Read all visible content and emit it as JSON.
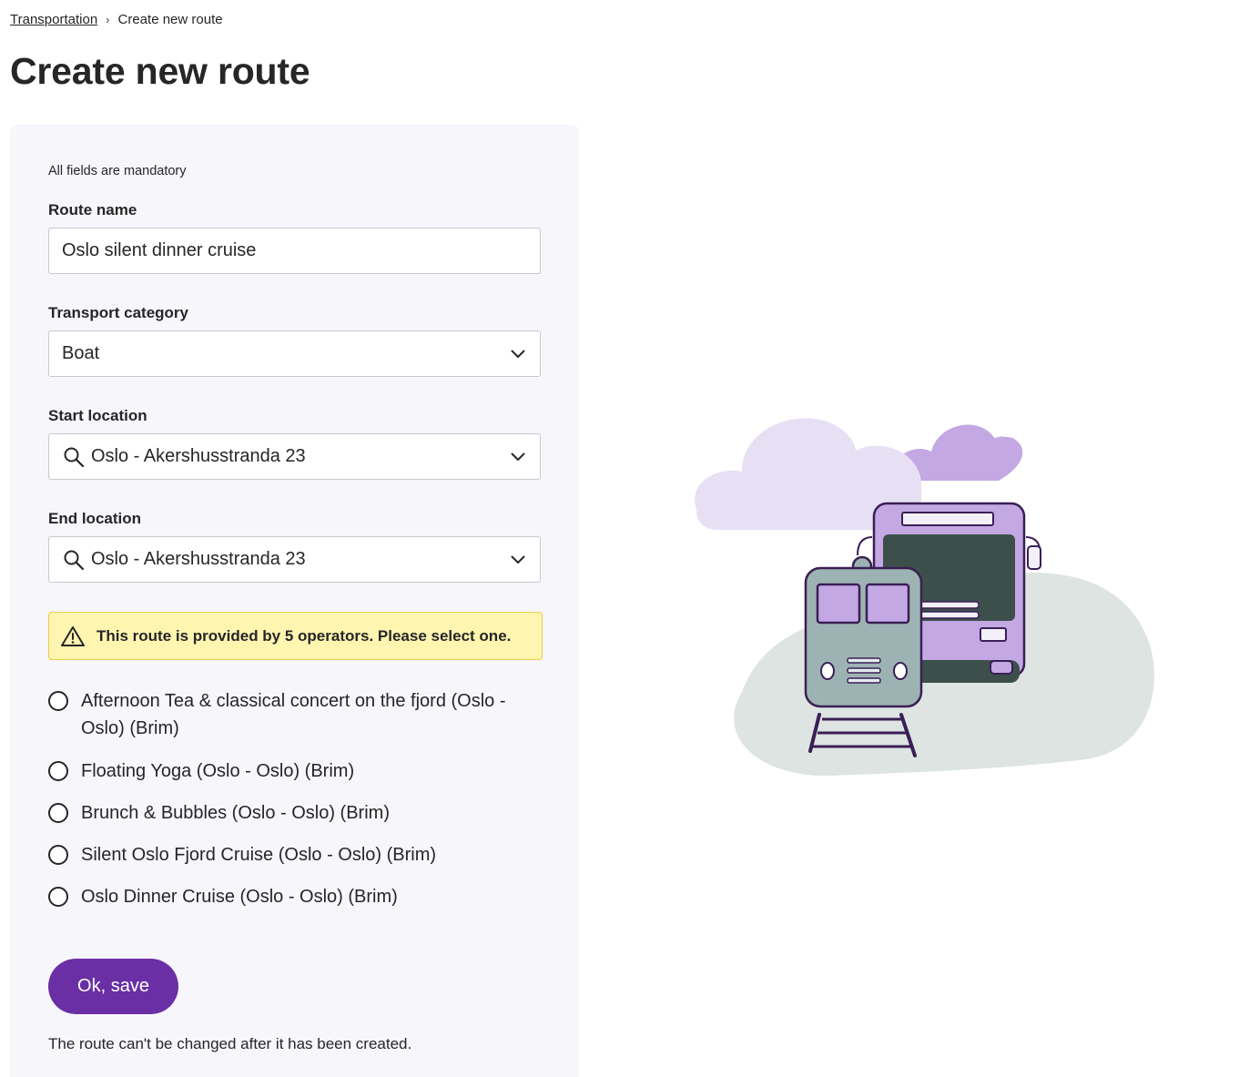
{
  "breadcrumb": {
    "parent": "Transportation",
    "separator": "›",
    "current": "Create new route"
  },
  "page": {
    "title": "Create new route"
  },
  "form": {
    "mandatory_note": "All fields are mandatory",
    "route_name": {
      "label": "Route name",
      "value": "Oslo silent dinner cruise"
    },
    "transport_category": {
      "label": "Transport category",
      "value": "Boat"
    },
    "start_location": {
      "label": "Start location",
      "value": "Oslo - Akershusstranda 23"
    },
    "end_location": {
      "label": "End location",
      "value": "Oslo - Akershusstranda 23"
    },
    "alert": {
      "text": "This route is provided by 5 operators. Please select one."
    },
    "operators": [
      {
        "label": "Afternoon Tea & classical concert on the fjord (Oslo - Oslo) (Brim)",
        "selected": false
      },
      {
        "label": "Floating Yoga (Oslo - Oslo) (Brim)",
        "selected": false
      },
      {
        "label": "Brunch & Bubbles (Oslo - Oslo) (Brim)",
        "selected": false
      },
      {
        "label": "Silent Oslo Fjord Cruise (Oslo - Oslo) (Brim)",
        "selected": false
      },
      {
        "label": "Oslo Dinner Cruise (Oslo - Oslo) (Brim)",
        "selected": false
      }
    ],
    "save_label": "Ok, save",
    "footer_note": "The route can't be changed after it has been created."
  },
  "colors": {
    "primary": "#6a2fa4",
    "panel_bg": "#f7f6fb",
    "alert_bg": "#fdf5b0",
    "alert_border": "#e6cf46"
  },
  "icons": {
    "chevron": "chevron-down-icon",
    "search": "search-icon",
    "warning": "warning-triangle-icon"
  }
}
